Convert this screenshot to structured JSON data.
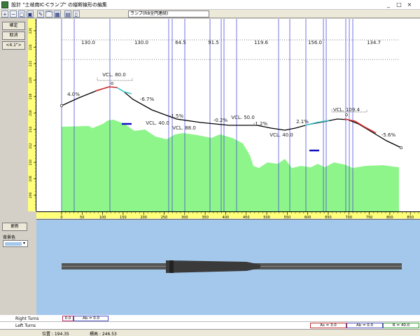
{
  "window": {
    "title": "設計 \"土岐南IC-Cランプ\" の縦断線形の編集",
    "minimize_glyph": "_",
    "maximize_glyph": "□",
    "close_glyph": "×"
  },
  "toolbar": {
    "ramp_select_value": "ランプ(R8全円連続)"
  },
  "left_panel": {
    "confirm_label": "確定",
    "cancel_label": "取消",
    "ratio_label": "<4.1\">",
    "update_label": "更新",
    "bg_color_label": "背景色"
  },
  "profile": {
    "section_lengths": [
      "130.0",
      "130.0",
      "64.5",
      "91.5",
      "119.6",
      "156.0",
      "134.7"
    ],
    "grades": [
      "4.0%",
      "-6.7%",
      "-1.5%",
      "-0.2%",
      "-1.2%",
      "2.1%",
      "-5.6%"
    ],
    "vcl_labels": [
      "VCL. 80.0",
      "VCL. 40.0",
      "VCL. 88.0",
      "VCL. 50.0",
      "VCL. 40.0",
      "VCL. 109.4"
    ],
    "h_ticks": [
      "0",
      "50",
      "100",
      "150",
      "200",
      "250",
      "300",
      "350",
      "400",
      "450",
      "500",
      "550",
      "600",
      "650",
      "700",
      "750",
      "800",
      "850"
    ],
    "v_ticks": [
      "206",
      "208",
      "210",
      "212",
      "214",
      "216",
      "218",
      "220",
      "222",
      "224",
      "226"
    ],
    "colors": {
      "ground_fill": "#8ef58a",
      "vline": "#3b3bdc",
      "curve_red": "#d23030",
      "curve_cyan": "#40c8c8",
      "ruler": "#ffff7a"
    }
  },
  "plan": {
    "bg_color": "#a3c8ec",
    "road_color": "#555555"
  },
  "turns": {
    "right_label": "Right Turns",
    "left_label": "Left Turns",
    "right_cells": [
      "0.0",
      "Ab = 0.0"
    ],
    "left_cells": [
      "As = 3.0",
      "Ab = 0.0",
      "R = 40.0"
    ]
  },
  "status": {
    "position": "位置 : 194.35",
    "elevation": "標高 : 246.53"
  }
}
